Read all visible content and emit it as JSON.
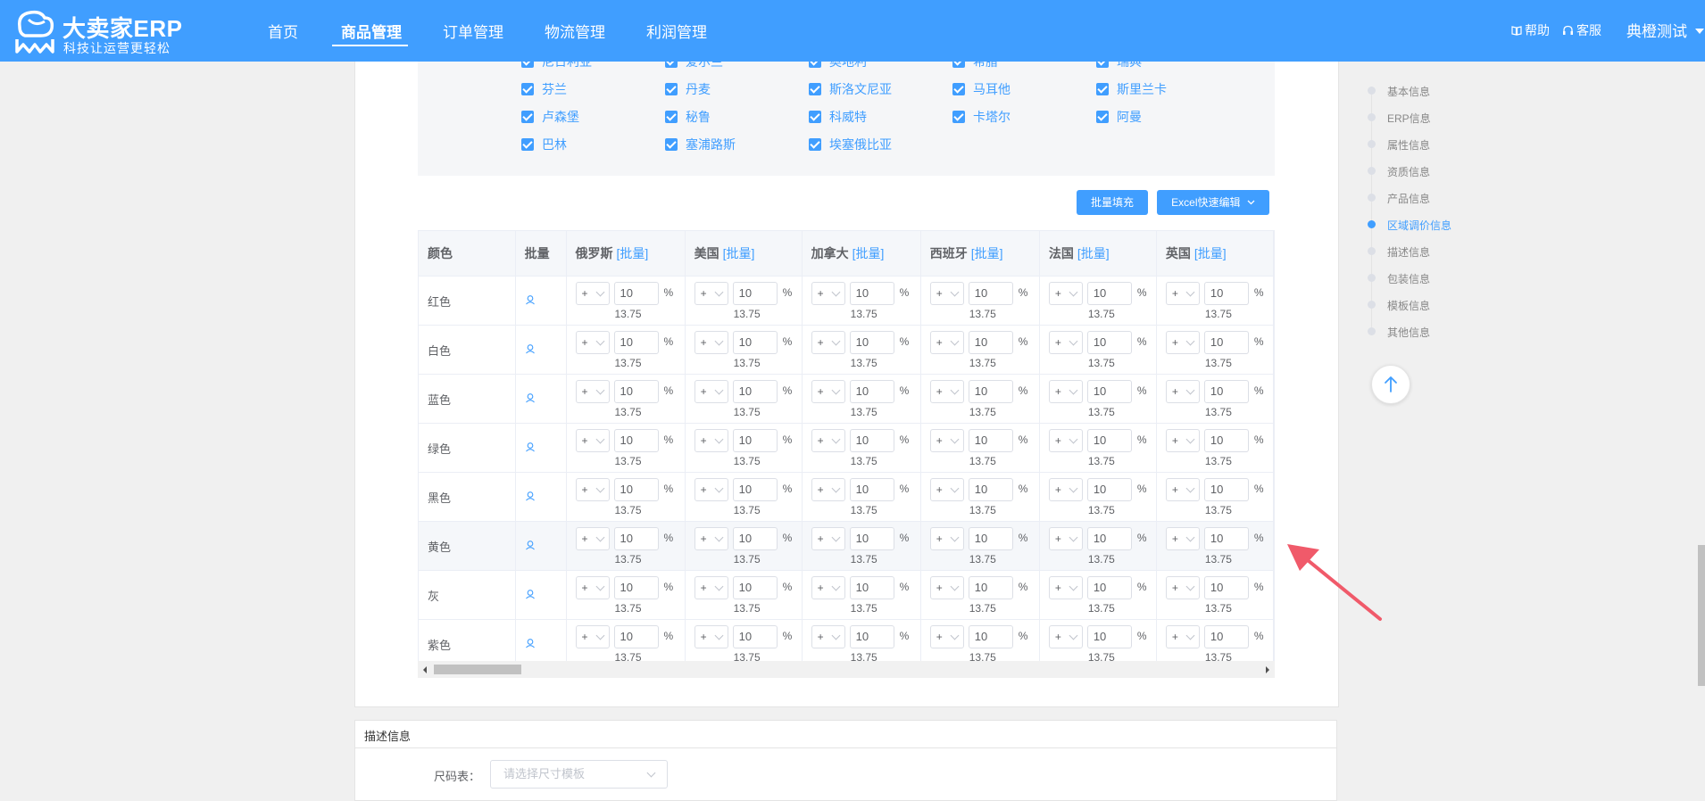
{
  "header": {
    "logo_title": "大卖家ERP",
    "logo_subtitle": "科技让运营更轻松",
    "nav": [
      {
        "label": "首页"
      },
      {
        "label": "商品管理"
      },
      {
        "label": "订单管理"
      },
      {
        "label": "物流管理"
      },
      {
        "label": "利润管理"
      }
    ],
    "active_nav": "商品管理",
    "help_label": "帮助",
    "service_label": "客服",
    "user_name": "典橙测试"
  },
  "countries": [
    "尼日利亚",
    "爱尔兰",
    "奥地利",
    "希腊",
    "瑞典",
    "芬兰",
    "丹麦",
    "斯洛文尼亚",
    "马耳他",
    "斯里兰卡",
    "卢森堡",
    "秘鲁",
    "科威特",
    "卡塔尔",
    "阿曼",
    "巴林",
    "塞浦路斯",
    "埃塞俄比亚"
  ],
  "buttons": {
    "batch_fill": "批量填充",
    "excel_edit": "Excel快速编辑"
  },
  "table": {
    "color_header": "颜色",
    "batch_header": "批量",
    "batch_link": "[批量]",
    "country_headers": [
      "俄罗斯",
      "美国",
      "加拿大",
      "西班牙",
      "法国",
      "英国"
    ],
    "rows": [
      "红色",
      "白色",
      "蓝色",
      "绿色",
      "黑色",
      "黄色",
      "灰",
      "紫色"
    ],
    "highlight_row": "黄色",
    "cell": {
      "sign": "+",
      "value": "10",
      "unit": "%",
      "calculated": "13.75"
    }
  },
  "describe": {
    "title": "描述信息",
    "size_label": "尺码表：",
    "size_placeholder": "请选择尺寸模板"
  },
  "anchor_nav": {
    "items": [
      "基本信息",
      "ERP信息",
      "属性信息",
      "资质信息",
      "产品信息",
      "区域调价信息",
      "描述信息",
      "包装信息",
      "模板信息",
      "其他信息"
    ],
    "active": "区域调价信息"
  },
  "colors": {
    "primary": "#409eff",
    "annotation_arrow": "#f05a6a"
  }
}
